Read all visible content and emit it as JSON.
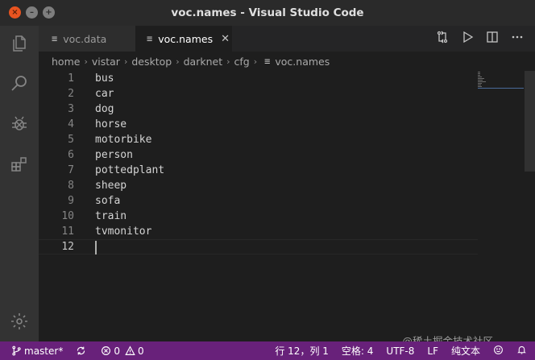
{
  "window": {
    "title": "voc.names - Visual Studio Code"
  },
  "tabs": [
    {
      "label": "voc.data",
      "active": false
    },
    {
      "label": "voc.names",
      "active": true,
      "close": "✕"
    }
  ],
  "breadcrumb": [
    "home",
    "vistar",
    "desktop",
    "darknet",
    "cfg",
    "voc.names"
  ],
  "editor": {
    "lines": [
      "bus",
      "car",
      "dog",
      "horse",
      "motorbike",
      "person",
      "pottedplant",
      "sheep",
      "sofa",
      "train",
      "tvmonitor",
      ""
    ],
    "line_numbers": [
      "1",
      "2",
      "3",
      "4",
      "5",
      "6",
      "7",
      "8",
      "9",
      "10",
      "11",
      "12"
    ],
    "current_line": 12
  },
  "statusbar": {
    "branch": "master*",
    "errors": "0",
    "warnings": "0",
    "position": "行 12，列 1",
    "indent": "空格: 4",
    "encoding": "UTF-8",
    "eol": "LF",
    "language": "纯文本"
  },
  "watermark": "@稀土掘金技术社区",
  "colors": {
    "accent": "#68217a",
    "close_button": "#e95420"
  }
}
